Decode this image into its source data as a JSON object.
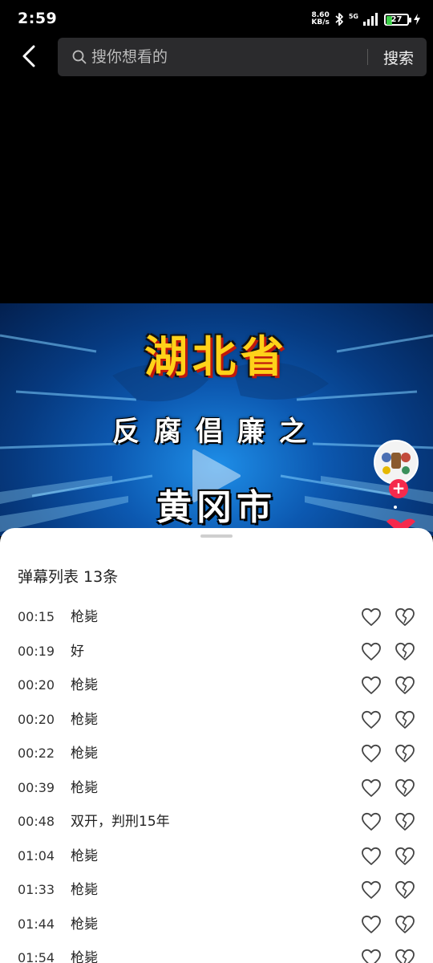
{
  "status_bar": {
    "time": "2:59",
    "net_speed_value": "8.60",
    "net_speed_unit": "KB/s",
    "network_type": "5G",
    "battery_level": "27",
    "battery_fraction": 0.27
  },
  "search": {
    "placeholder": "搜你想看的",
    "button_label": "搜索"
  },
  "video": {
    "title_line1": "湖北省",
    "title_line2": "反腐倡廉之",
    "title_line3": "黄冈市"
  },
  "danmaku_sheet": {
    "title": "弹幕列表 13条",
    "items": [
      {
        "time": "00:15",
        "text": "枪毙"
      },
      {
        "time": "00:19",
        "text": "好"
      },
      {
        "time": "00:20",
        "text": "枪毙"
      },
      {
        "time": "00:20",
        "text": "枪毙"
      },
      {
        "time": "00:22",
        "text": "枪毙"
      },
      {
        "time": "00:39",
        "text": "枪毙"
      },
      {
        "time": "00:48",
        "text": "双开，判刑15年"
      },
      {
        "time": "01:04",
        "text": "枪毙"
      },
      {
        "time": "01:33",
        "text": "枪毙"
      },
      {
        "time": "01:44",
        "text": "枪毙"
      },
      {
        "time": "01:54",
        "text": "枪毙"
      }
    ]
  },
  "colors": {
    "accent_red": "#f5294c",
    "sheet_bg": "#ffffff",
    "search_bg": "#2b2b2d"
  }
}
